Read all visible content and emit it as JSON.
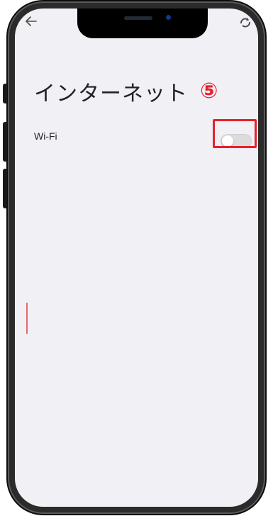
{
  "screen": {
    "title": "インターネット",
    "settings": [
      {
        "label": "Wi-Fi",
        "toggle_on": false
      }
    ]
  },
  "annotation": {
    "step_number": "⑤",
    "highlight_color": "#e8202a"
  },
  "status_bar": {
    "left_icon": "back-arrow-icon",
    "right_icon": "sync-icon"
  },
  "colors": {
    "screen_background": "#f1f0f5",
    "toggle_off": "#dcdcdc",
    "text": "#222222"
  }
}
